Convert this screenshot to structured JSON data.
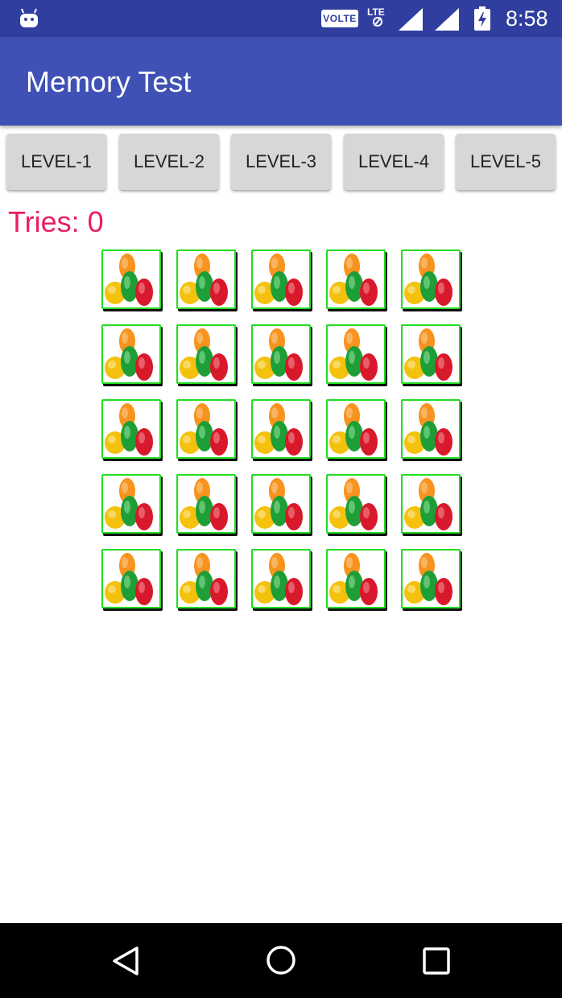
{
  "status_bar": {
    "volte": "VOLTE",
    "network": "LTE",
    "time": "8:58",
    "icons": [
      "android-icon",
      "volte-icon",
      "lte-icon",
      "signal-icon",
      "signal-icon",
      "battery-charging-icon"
    ]
  },
  "app_bar": {
    "title": "Memory Test"
  },
  "levels": [
    "LEVEL-1",
    "LEVEL-2",
    "LEVEL-3",
    "LEVEL-4",
    "LEVEL-5"
  ],
  "tries": {
    "label": "Tries: ",
    "value": "0"
  },
  "board": {
    "rows": 5,
    "cols": 5,
    "card_icon": "jellybeans-icon",
    "card_border_color": "#22DD22"
  },
  "nav_bar": {
    "icons": [
      "back-icon",
      "home-icon",
      "recent-apps-icon"
    ]
  },
  "colors": {
    "status_bar": "#303F9F",
    "app_bar": "#3F51B5",
    "tries": "#E91E63",
    "button": "#D6D7D7"
  }
}
